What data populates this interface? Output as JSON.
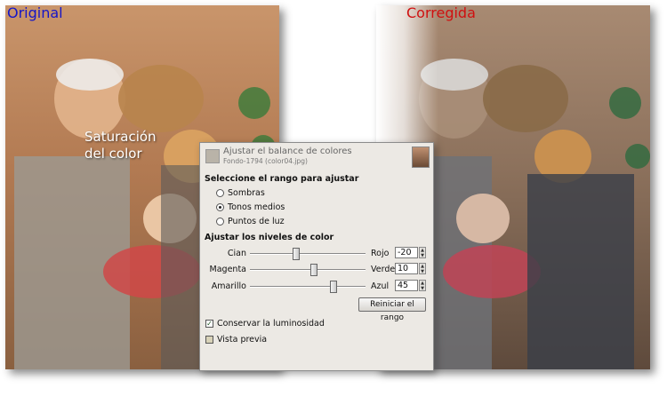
{
  "captions": {
    "left": "Original",
    "right": "Corregida"
  },
  "annotation": {
    "line1": "Saturación",
    "line2": "del color"
  },
  "dialog": {
    "title": "Ajustar el balance de colores",
    "subtitle": "Fondo-1794 (color04.jpg)",
    "range_section": "Seleccione el rango para ajustar",
    "ranges": [
      {
        "label": "Sombras",
        "selected": false
      },
      {
        "label": "Tonos medios",
        "selected": true
      },
      {
        "label": "Puntos de luz",
        "selected": false
      }
    ],
    "levels_section": "Ajustar los niveles de color",
    "sliders": [
      {
        "left": "Cian",
        "right": "Rojo",
        "value": "-20",
        "level": -20
      },
      {
        "left": "Magenta",
        "right": "Verde",
        "value": "10",
        "level": 10
      },
      {
        "left": "Amarillo",
        "right": "Azul",
        "value": "45",
        "level": 45
      }
    ],
    "reset_button": "Reiniciar el rango",
    "preserve_luminosity": {
      "label": "Conservar la luminosidad",
      "checked": true
    },
    "preview": {
      "label": "Vista previa",
      "checked": false
    }
  },
  "colors": {
    "caption_left": "#1515c8",
    "caption_right": "#d01010"
  }
}
